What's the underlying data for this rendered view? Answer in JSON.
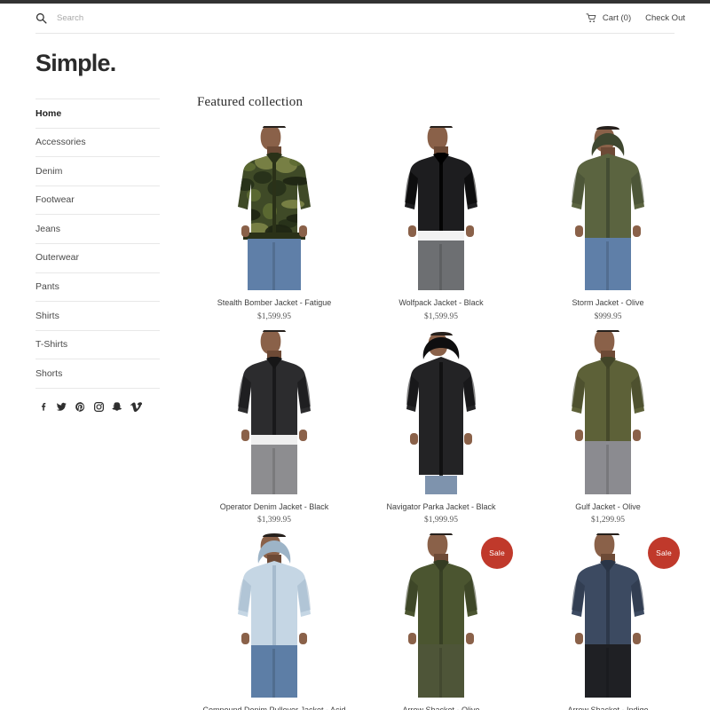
{
  "theme": {
    "accent_sale": "#c0392b",
    "top_strip": "#333333",
    "text": "#333333",
    "divider": "#e8e8e8"
  },
  "utility": {
    "search_icon": "search-icon",
    "search_placeholder": "Search",
    "search_value": "",
    "cart_icon": "shopping-cart-icon",
    "cart_label": "Cart (0)",
    "checkout_label": "Check Out"
  },
  "masthead": {
    "logo": "Simple."
  },
  "sidebar": {
    "items": [
      {
        "label": "Home",
        "active": true
      },
      {
        "label": "Accessories",
        "active": false
      },
      {
        "label": "Denim",
        "active": false
      },
      {
        "label": "Footwear",
        "active": false
      },
      {
        "label": "Jeans",
        "active": false
      },
      {
        "label": "Outerwear",
        "active": false
      },
      {
        "label": "Pants",
        "active": false
      },
      {
        "label": "Shirts",
        "active": false
      },
      {
        "label": "T-Shirts",
        "active": false
      },
      {
        "label": "Shorts",
        "active": false
      }
    ],
    "social": [
      "facebook-icon",
      "twitter-icon",
      "pinterest-icon",
      "instagram-icon",
      "snapchat-icon",
      "vimeo-icon"
    ]
  },
  "main": {
    "section_title": "Featured collection",
    "products": [
      {
        "title": "Stealth Bomber Jacket - Fatigue",
        "price": "$1,599.95",
        "sale": false,
        "art": "camo-bomber"
      },
      {
        "title": "Wolfpack Jacket - Black",
        "price": "$1,599.95",
        "sale": false,
        "art": "black-bomber"
      },
      {
        "title": "Storm Jacket - Olive",
        "price": "$999.95",
        "sale": false,
        "art": "olive-hooded"
      },
      {
        "title": "Operator Denim Jacket - Black",
        "price": "$1,399.95",
        "sale": false,
        "art": "black-denim"
      },
      {
        "title": "Navigator Parka Jacket - Black",
        "price": "$1,999.95",
        "sale": false,
        "art": "black-parka"
      },
      {
        "title": "Gulf Jacket - Olive",
        "price": "$1,299.95",
        "sale": false,
        "art": "olive-shirt"
      },
      {
        "title": "Compound Denim Pullover Jacket - Acid",
        "price": "",
        "sale": false,
        "art": "acid-pullover"
      },
      {
        "title": "Arrow Shacket - Olive",
        "price": "",
        "sale": true,
        "art": "olive-shacket"
      },
      {
        "title": "Arrow Shacket - Indigo",
        "price": "",
        "sale": true,
        "art": "indigo-shacket"
      }
    ],
    "sale_badge_label": "Sale"
  }
}
